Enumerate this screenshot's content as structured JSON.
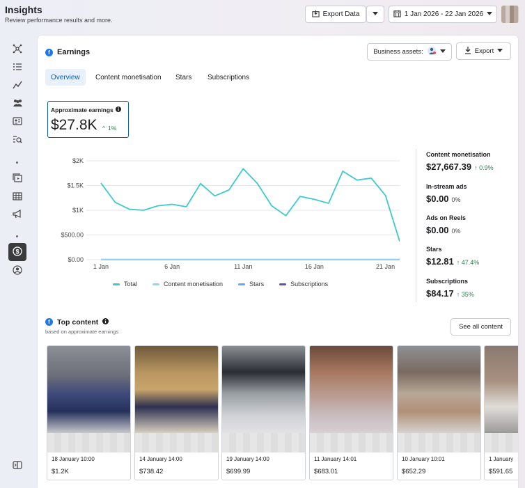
{
  "header": {
    "title": "Insights",
    "subtitle": "Review performance results and more.",
    "export_data_label": "Export Data",
    "date_range": "1 Jan 2026 - 22 Jan 2026"
  },
  "earnings": {
    "title": "Earnings",
    "business_assets_label": "Business assets:",
    "export_label": "Export",
    "tabs": [
      "Overview",
      "Content monetisation",
      "Stars",
      "Subscriptions"
    ],
    "active_tab": "Overview",
    "approx_label": "Approximate earnings",
    "approx_value": "$27.8K",
    "approx_change": "1%"
  },
  "stats": [
    {
      "label": "Content monetisation",
      "value": "$27,667.39",
      "change": "0.9%",
      "trend": "up"
    },
    {
      "label": "In-stream ads",
      "value": "$0.00",
      "change": "0%",
      "trend": "flat"
    },
    {
      "label": "Ads on Reels",
      "value": "$0.00",
      "change": "0%",
      "trend": "flat"
    },
    {
      "label": "Stars",
      "value": "$12.81",
      "change": "47.4%",
      "trend": "up"
    },
    {
      "label": "Subscriptions",
      "value": "$84.17",
      "change": "35%",
      "trend": "up"
    }
  ],
  "chart_data": {
    "type": "line",
    "x": [
      1,
      2,
      3,
      4,
      5,
      6,
      7,
      8,
      9,
      10,
      11,
      12,
      13,
      14,
      15,
      16,
      17,
      18,
      19,
      20,
      21,
      22
    ],
    "x_tick_labels": [
      "1 Jan",
      "6 Jan",
      "11 Jan",
      "16 Jan",
      "21 Jan"
    ],
    "x_tick_positions": [
      1,
      6,
      11,
      16,
      21
    ],
    "y_tick_labels": [
      "$0.00",
      "$500.00",
      "$1K",
      "$1.5K",
      "$2K"
    ],
    "y_tick_values": [
      0,
      500,
      1000,
      1500,
      2000
    ],
    "ylim": [
      0,
      2000
    ],
    "grid": true,
    "legend": "bottom",
    "series": [
      {
        "name": "Total",
        "color": "#3ec9cc",
        "values": [
          1550,
          1160,
          1020,
          1000,
          1090,
          1120,
          1070,
          1540,
          1290,
          1410,
          1840,
          1540,
          1090,
          890,
          1280,
          1220,
          1140,
          1790,
          1610,
          1650,
          1300,
          370
        ]
      },
      {
        "name": "Content monetisation",
        "color": "#8ed8f0",
        "values": [
          4,
          4,
          4,
          4,
          4,
          4,
          4,
          4,
          4,
          4,
          4,
          4,
          4,
          4,
          4,
          4,
          4,
          4,
          4,
          4,
          4,
          4
        ]
      },
      {
        "name": "Stars",
        "color": "#6aa8f0",
        "values": [
          1,
          1,
          1,
          1,
          1,
          1,
          1,
          1,
          1,
          1,
          1,
          1,
          1,
          1,
          1,
          1,
          1,
          1,
          1,
          1,
          1,
          1
        ]
      },
      {
        "name": "Subscriptions",
        "color": "#5a52b8",
        "values": [
          4,
          4,
          4,
          4,
          4,
          4,
          4,
          4,
          4,
          4,
          4,
          4,
          4,
          4,
          4,
          4,
          4,
          4,
          4,
          4,
          4,
          4
        ]
      }
    ]
  },
  "top_content": {
    "title": "Top content",
    "subtitle": "based on approximate earnings",
    "see_all_label": "See all content",
    "items": [
      {
        "date": "18 January 10:00",
        "amount": "$1.2K"
      },
      {
        "date": "14 January 14:00",
        "amount": "$738.42"
      },
      {
        "date": "19 January 14:00",
        "amount": "$699.99"
      },
      {
        "date": "11 January 14:01",
        "amount": "$683.01"
      },
      {
        "date": "10 January 10:01",
        "amount": "$652.29"
      },
      {
        "date": "1 January",
        "amount": "$591.65"
      }
    ]
  },
  "colors": {
    "accent": "#0b5cad",
    "positive": "#2e7d4f",
    "facebook": "#1877f2"
  }
}
